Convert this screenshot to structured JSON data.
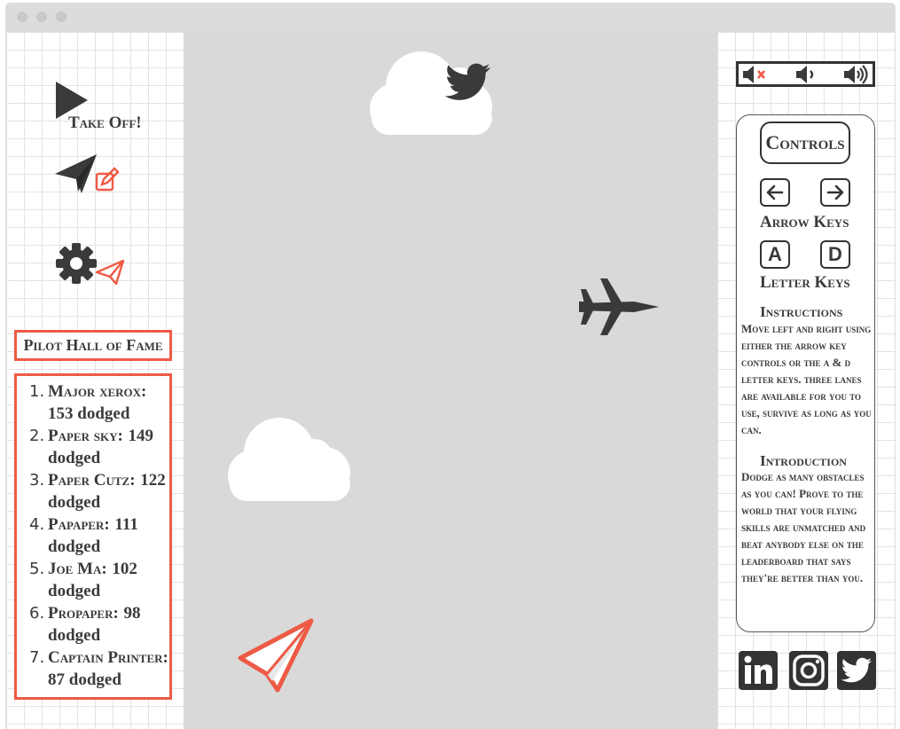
{
  "left_panel": {
    "takeoff_label": "Take Off!",
    "hall_of_fame": {
      "title": "Pilot Hall of Fame",
      "entries": [
        {
          "rank": "1.",
          "name": "Major xerox:",
          "score": "153 dodged"
        },
        {
          "rank": "2.",
          "name": "Paper sky:",
          "score": "149 dodged"
        },
        {
          "rank": "3.",
          "name": "Paper Cutz:",
          "score": "122 dodged"
        },
        {
          "rank": "4.",
          "name": "Papaper:",
          "score": "111 dodged"
        },
        {
          "rank": "5.",
          "name": "Joe Ma:",
          "score": "102 dodged"
        },
        {
          "rank": "6.",
          "name": "Propaper:",
          "score": "98 dodged"
        },
        {
          "rank": "7.",
          "name": "Captain Printer:",
          "score": "87 dodged"
        }
      ]
    }
  },
  "right_panel": {
    "controls": {
      "title": "Controls",
      "arrow_keys_label": "Arrow Keys",
      "letter_key_left": "A",
      "letter_key_right": "D",
      "letter_keys_label": "Letter Keys",
      "instructions_title": "Instructions",
      "instructions_text": "Move left and right using either the arrow key controls or the a & d letter keys. three lanes are available for you to use, survive as long as you can.",
      "introduction_title": "Introduction",
      "introduction_text": "Dodge as many obstacles as you can! Prove to the world that your flying skills are unmatched and beat anybody else on the leaderboard that says they're better than you."
    },
    "social": [
      "linkedin-icon",
      "instagram-icon",
      "twitter-icon"
    ]
  },
  "colors": {
    "accent": "#ee5a45",
    "dark": "#3a3a3a",
    "game_bg": "#d9d9d9",
    "cloud": "#ffffff"
  }
}
